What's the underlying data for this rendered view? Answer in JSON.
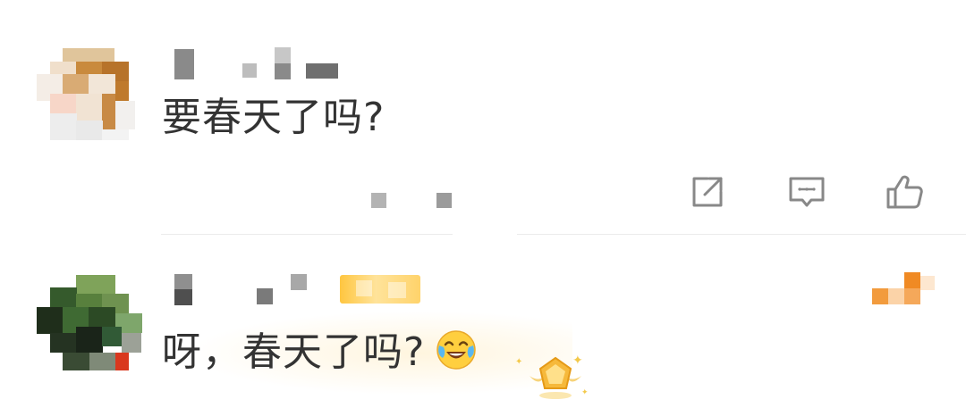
{
  "comments": [
    {
      "text": "要春天了吗?",
      "actions": {
        "share_icon": "share-icon",
        "reply_icon": "reply-comment-icon",
        "like_icon": "thumbs-up-icon"
      }
    },
    {
      "text": "呀，春天了吗?",
      "emoji": "laughing-crying-emoji"
    }
  ],
  "colors": {
    "text": "#333333",
    "icon": "#888888",
    "badge": "#ffc640",
    "fan_badge": "#f08a24"
  }
}
